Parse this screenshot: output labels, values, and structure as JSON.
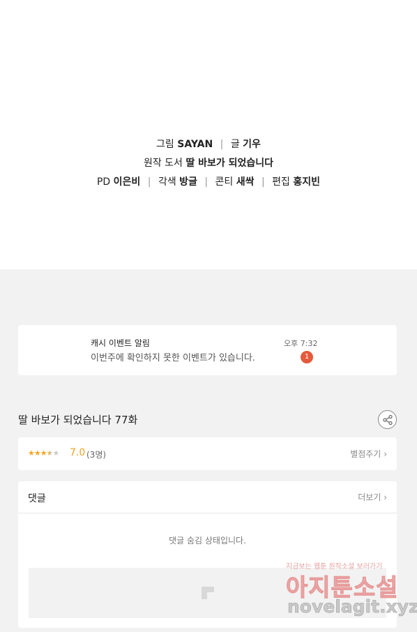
{
  "credits": {
    "line1": {
      "art_label": "그림",
      "art_value": "SAYAN",
      "sep": "|",
      "story_label": "글",
      "story_value": "기우"
    },
    "line2": {
      "original_label": "원작 도서",
      "original_value": "딸 바보가 되었습니다"
    },
    "line3": {
      "pd_label": "PD",
      "pd_value": "이은비",
      "adapt_label": "각색",
      "adapt_value": "방글",
      "conti_label": "콘티",
      "conti_value": "새싹",
      "edit_label": "편집",
      "edit_value": "홍지빈",
      "sep": "|"
    }
  },
  "notification": {
    "title": "캐시 이벤트 알림",
    "body": "이번주에 확인하지 못한 이벤트가 있습니다.",
    "time": "오후 7:32",
    "badge": "1"
  },
  "episode": {
    "title": "딸 바보가 되었습니다 77화"
  },
  "rating": {
    "stars_value": 3.5,
    "score": "7.0",
    "count": "(3명)",
    "rate_link": "별점주기",
    "chevron": "›",
    "star_color": "#f5a623"
  },
  "comments": {
    "title": "댓글",
    "more_link": "더보기",
    "chevron": "›",
    "hidden_note": "댓글 숨김 상태입니다."
  },
  "watermark": {
    "top": "지금보는 웹툰 원작소설 보러가기",
    "mid": "아지툰소설",
    "bottom": "novelagit.xyz"
  },
  "colors": {
    "badge": "#e45a3c",
    "accent": "#f0a020",
    "background": "#f2f2f2"
  }
}
